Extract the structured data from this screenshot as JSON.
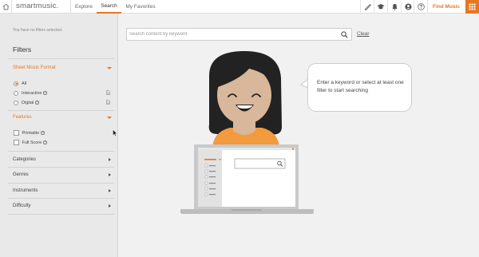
{
  "topbar": {
    "logo": "smartmusic.",
    "nav": [
      "Explore",
      "Search",
      "My Favorites"
    ],
    "active_nav": "Search",
    "find_music": "Find Music",
    "accent": "#e87722"
  },
  "sidebar": {
    "no_filters": "You have no filters selected.",
    "title": "Filters",
    "sheet_music_format": {
      "label": "Sheet Music Format",
      "options": [
        "All",
        "Interactive",
        "Digital"
      ],
      "selected": "All"
    },
    "features": {
      "label": "Features",
      "options": [
        "Printable",
        "Full Score"
      ]
    },
    "collapsed": [
      "Categories",
      "Genres",
      "Instruments",
      "Difficulty"
    ]
  },
  "search": {
    "placeholder": "Search content by keyword",
    "value": "",
    "clear_label": "Clear"
  },
  "bubble": {
    "message": "Enter a keyword or select at least one filter to start searching"
  }
}
